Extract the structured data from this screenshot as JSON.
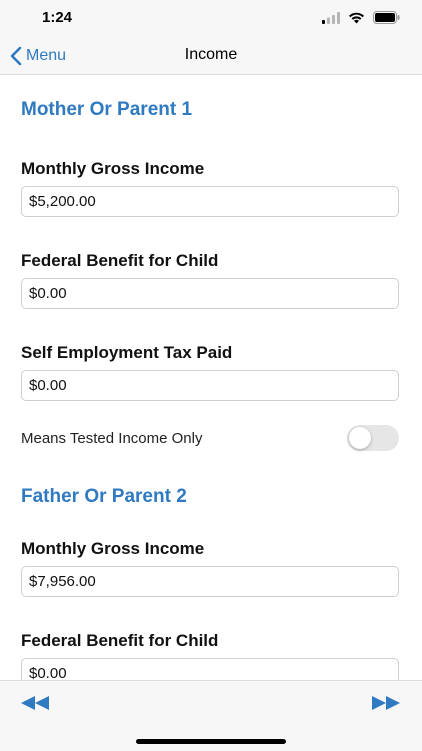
{
  "status": {
    "time": "1:24"
  },
  "nav": {
    "back_label": "Menu",
    "title": "Income"
  },
  "parent1": {
    "title": "Mother Or Parent 1",
    "monthly_gross_income": {
      "label": "Monthly Gross Income",
      "value": "$5,200.00"
    },
    "federal_benefit": {
      "label": "Federal Benefit for Child",
      "value": "$0.00"
    },
    "self_employment_tax": {
      "label": "Self Employment Tax Paid",
      "value": "$0.00"
    },
    "means_tested": {
      "label": "Means Tested Income Only",
      "checked": false
    }
  },
  "parent2": {
    "title": "Father Or Parent 2",
    "monthly_gross_income": {
      "label": "Monthly Gross Income",
      "value": "$7,956.00"
    },
    "federal_benefit": {
      "label": "Federal Benefit for Child",
      "value": "$0.00"
    }
  },
  "toolbar": {
    "prev_icon": "rewind-icon",
    "next_icon": "fast-forward-icon"
  },
  "colors": {
    "accent": "#2f7ac0",
    "toggle_off": "#e6e6e6",
    "bar_bg": "#f7f7f7"
  }
}
